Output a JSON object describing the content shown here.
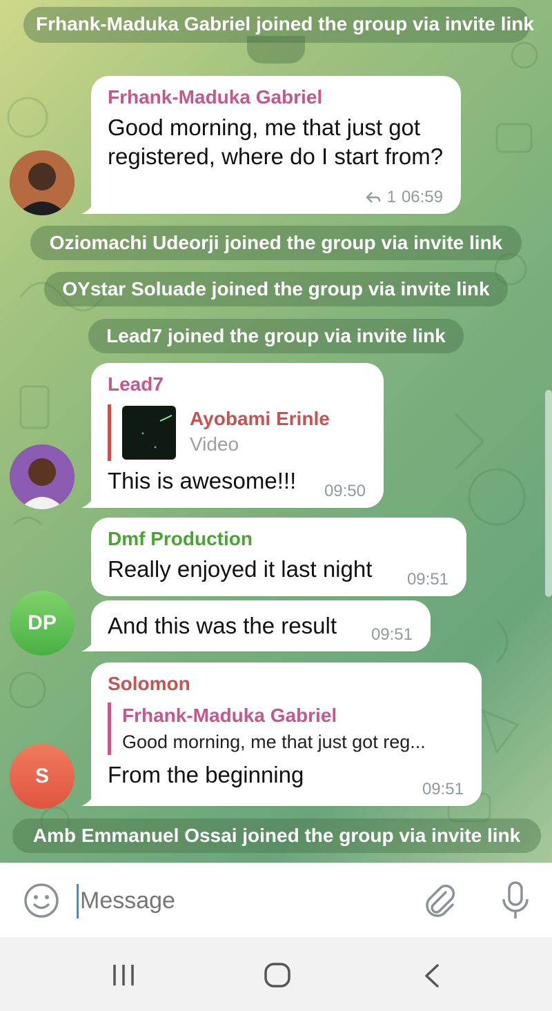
{
  "services": {
    "s1": "Frhank-Maduka Gabriel joined the group via invite link",
    "s2": "Oziomachi Udeorji joined the group via invite link",
    "s3": "OYstar Soluade joined the group via invite link",
    "s4": "Lead7 joined the group via invite link",
    "s5": "Amb Emmanuel Ossai joined the group via invite link"
  },
  "messages": {
    "m1": {
      "sender": "Frhank-Maduka Gabriel",
      "sender_color": "#c5578f",
      "text": "Good morning, me that just got registered, where do I start from?",
      "replies": "1",
      "time": "06:59"
    },
    "m2": {
      "sender": "Lead7",
      "sender_color": "#c5578f",
      "reply_name": "Ayobami Erinle",
      "reply_color": "#c8524f",
      "reply_type": "Video",
      "text": "This is awesome!!!",
      "time": "09:50"
    },
    "m3": {
      "sender": "Dmf Production",
      "sender_color": "#4aa431",
      "text": "Really enjoyed it last night",
      "time": "09:51"
    },
    "m4": {
      "text": "And this was the result",
      "time": "09:51",
      "avatar_initials": "DP"
    },
    "m5": {
      "sender": "Solomon",
      "sender_color": "#c8524f",
      "reply_name": "Frhank-Maduka Gabriel",
      "reply_color": "#c5578f",
      "reply_text": "Good morning, me that just got reg...",
      "text": "From the beginning",
      "time": "09:51",
      "avatar_initials": "S"
    }
  },
  "input": {
    "placeholder": "Message"
  },
  "icons": {
    "emoji": "emoji-icon",
    "attach": "paperclip-icon",
    "mic": "microphone-icon",
    "recent": "recent-apps-icon",
    "home": "home-icon",
    "back": "back-icon"
  }
}
